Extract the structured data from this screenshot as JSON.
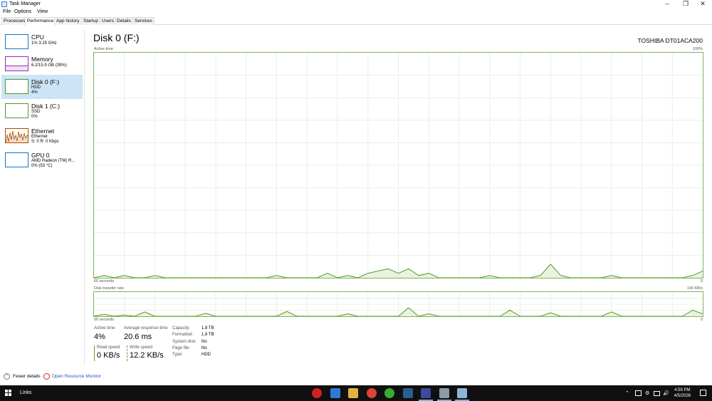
{
  "window": {
    "title": "Task Manager"
  },
  "menu": [
    "File",
    "Options",
    "View"
  ],
  "tabs": [
    "Processes",
    "Performance",
    "App history",
    "Startup",
    "Users",
    "Details",
    "Services"
  ],
  "active_tab": "Performance",
  "sidebar": [
    {
      "name": "CPU",
      "sub1": "1% 3.25 GHz",
      "sub2": "",
      "sub3": "",
      "color": "#1175c8"
    },
    {
      "name": "Memory",
      "sub1": "6.2/15.9 GB (39%)",
      "sub2": "",
      "sub3": "",
      "color": "#9b2fae"
    },
    {
      "name": "Disk 0 (F:)",
      "sub1": "HDD",
      "sub2": "4%",
      "sub3": "",
      "color": "#4d9c22"
    },
    {
      "name": "Disk 1 (C:)",
      "sub1": "SSD",
      "sub2": "0%",
      "sub3": "",
      "color": "#4d9c22"
    },
    {
      "name": "Ethernet",
      "sub1": "Ethernet",
      "sub2": "S: 0  R: 0 Kbps",
      "sub3": "",
      "color": "#a74f01"
    },
    {
      "name": "GPU 0",
      "sub1": "AMD Radeon (TM) R...",
      "sub2": "0% (53 °C)",
      "sub3": "",
      "color": "#1175c8"
    }
  ],
  "main": {
    "title": "Disk 0 (F:)",
    "device": "TOSHIBA DT01ACA200",
    "graph1": {
      "label": "Active time",
      "max": "100%",
      "time": "60 seconds",
      "min": "0"
    },
    "graph2": {
      "label": "Disk transfer rate",
      "max": "100 KB/s",
      "time": "60 seconds",
      "min": "0"
    }
  },
  "stats": {
    "active_time_label": "Active time",
    "active_time_value": "4%",
    "avg_response_label": "Average response time",
    "avg_response_value": "20.6 ms",
    "read_speed_label": "Read speed",
    "read_speed_value": "0 KB/s",
    "write_speed_label": "Write speed",
    "write_speed_value": "12.2 KB/s"
  },
  "info": [
    {
      "key": "Capacity:",
      "value": "1.8 TB"
    },
    {
      "key": "Formatted:",
      "value": "1.8 TB"
    },
    {
      "key": "System disk:",
      "value": "No"
    },
    {
      "key": "Page file:",
      "value": "No"
    },
    {
      "key": "Type:",
      "value": "HDD"
    }
  ],
  "footer": {
    "fewer_details": "Fewer details",
    "open_resource_monitor": "Open Resource Monitor"
  },
  "taskbar": {
    "label": "Links",
    "time": "4:59 PM",
    "date": "4/5/2026",
    "icons": [
      {
        "name": "opera-icon",
        "color": "#d21f1f"
      },
      {
        "name": "app-icon-multicolor",
        "color": "#2d7ad6"
      },
      {
        "name": "file-explorer-icon",
        "color": "#e3b341"
      },
      {
        "name": "chrome-icon",
        "color": "#db4437"
      },
      {
        "name": "phone-icon",
        "color": "#3aaa35"
      },
      {
        "name": "steam-icon",
        "color": "#2a5f8f"
      },
      {
        "name": "floppy-icon",
        "color": "#3b4b9e"
      },
      {
        "name": "tool-icon",
        "color": "#8a9aa8"
      },
      {
        "name": "task-manager-icon",
        "color": "#8fb4d9"
      }
    ]
  },
  "chart_data": [
    {
      "type": "area",
      "title": "Active time",
      "x": [
        60,
        59,
        58,
        57,
        56,
        55,
        54,
        53,
        52,
        51,
        50,
        49,
        48,
        47,
        46,
        45,
        44,
        43,
        42,
        41,
        40,
        39,
        38,
        37,
        36,
        35,
        34,
        33,
        32,
        31,
        30,
        29,
        28,
        27,
        26,
        25,
        24,
        23,
        22,
        21,
        20,
        19,
        18,
        17,
        16,
        15,
        14,
        13,
        12,
        11,
        10,
        9,
        8,
        7,
        6,
        5,
        4,
        3,
        2,
        1,
        0
      ],
      "values": [
        0,
        1,
        0,
        1,
        0,
        0,
        1,
        0,
        0,
        0,
        0,
        0,
        0,
        0,
        0,
        0,
        0,
        0,
        1,
        0,
        0,
        0,
        0,
        2,
        0,
        1,
        0,
        2,
        3,
        4,
        2,
        4,
        1,
        2,
        0,
        0,
        0,
        0,
        0,
        1,
        0,
        0,
        0,
        0,
        1,
        6,
        1,
        0,
        0,
        0,
        0,
        1,
        0,
        0,
        0,
        0,
        0,
        0,
        0,
        1,
        3
      ],
      "xlabel": "60 seconds",
      "ylim": [
        0,
        100
      ],
      "color": "#4d9c22"
    },
    {
      "type": "area",
      "title": "Disk transfer rate",
      "x": [
        60,
        59,
        58,
        57,
        56,
        55,
        54,
        53,
        52,
        51,
        50,
        49,
        48,
        47,
        46,
        45,
        44,
        43,
        42,
        41,
        40,
        39,
        38,
        37,
        36,
        35,
        34,
        33,
        32,
        31,
        30,
        29,
        28,
        27,
        26,
        25,
        24,
        23,
        22,
        21,
        20,
        19,
        18,
        17,
        16,
        15,
        14,
        13,
        12,
        11,
        10,
        9,
        8,
        7,
        6,
        5,
        4,
        3,
        2,
        1,
        0
      ],
      "values": [
        0,
        8,
        0,
        5,
        0,
        18,
        0,
        0,
        0,
        0,
        0,
        12,
        0,
        0,
        0,
        0,
        0,
        0,
        0,
        20,
        0,
        0,
        0,
        0,
        0,
        10,
        0,
        0,
        0,
        0,
        0,
        35,
        0,
        10,
        0,
        0,
        0,
        0,
        0,
        0,
        0,
        25,
        0,
        0,
        0,
        14,
        0,
        0,
        0,
        0,
        0,
        18,
        0,
        0,
        0,
        0,
        0,
        0,
        0,
        25,
        10
      ],
      "xlabel": "60 seconds",
      "ylim": [
        0,
        100
      ],
      "color": "#4d9c22"
    }
  ]
}
